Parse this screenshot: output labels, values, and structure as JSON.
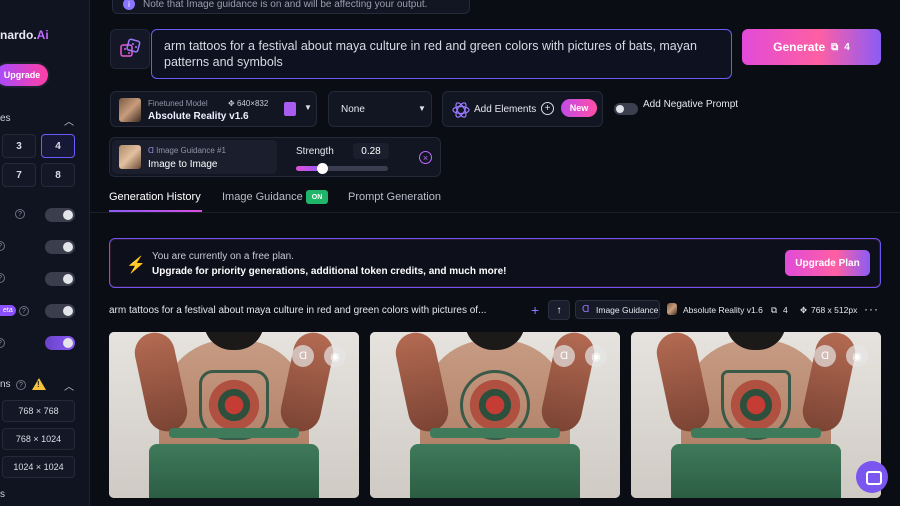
{
  "sidebar": {
    "brand": "nardo.",
    "brand_ai": "Ai",
    "upgrade_label": "Upgrade",
    "section_images_label": "es",
    "num_images": [
      "3",
      "4",
      "7",
      "8"
    ],
    "beta_label": "eta",
    "dimensions_label": "ns",
    "resolutions": [
      "768 × 768",
      "768 × 1024",
      "1024 × 1024"
    ],
    "bottom_label": "s"
  },
  "notice": {
    "text": "Note that Image guidance is on and will be affecting your output."
  },
  "prompt": {
    "text": "arm tattoos for a festival about maya culture in red and green colors with pictures of bats, mayan patterns and symbols"
  },
  "generate": {
    "label": "Generate",
    "tokens": "4"
  },
  "model": {
    "caption": "Finetuned Model",
    "dims": "640×832",
    "name": "Absolute Reality v1.6"
  },
  "style_select": {
    "value": "None"
  },
  "add_elements": {
    "label": "Add Elements",
    "badge": "New"
  },
  "negative_prompt": {
    "label": "Add Negative Prompt"
  },
  "image_guidance": {
    "caption": "Image Guidance #1",
    "type": "Image to Image",
    "strength_label": "Strength",
    "strength_value": "0.28",
    "strength": 0.28
  },
  "tabs": [
    {
      "label": "Generation History"
    },
    {
      "label": "Image Guidance",
      "badge": "ON"
    },
    {
      "label": "Prompt Generation"
    }
  ],
  "plan_banner": {
    "line1": "You are currently on a free plan.",
    "line2": "Upgrade for priority generations, additional token credits, and much more!",
    "button": "Upgrade Plan"
  },
  "generation": {
    "prompt": "arm tattoos for a festival about maya culture in red and green colors with pictures of...",
    "chip": "Image Guidance",
    "model": "Absolute Reality v1.6",
    "count": "4",
    "size": "768 x 512px"
  },
  "colors": {
    "accent": "#8b5cf6",
    "pink": "#ff5fa2",
    "background": "#0b0d14"
  }
}
